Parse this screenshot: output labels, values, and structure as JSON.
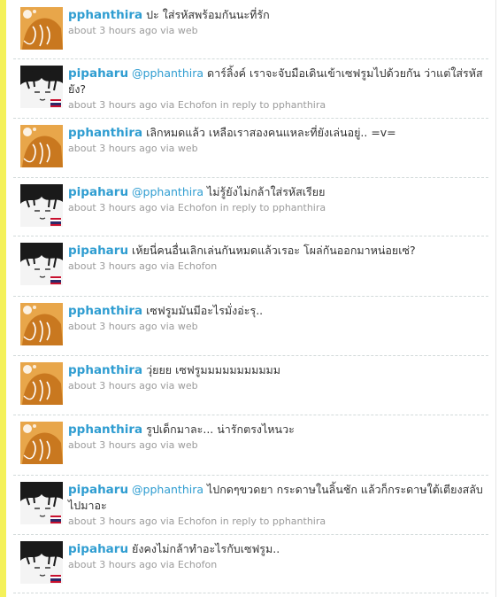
{
  "tweets": [
    {
      "user": "pphanthira",
      "avatar": "orange",
      "mention": "",
      "text": "ปะ ใส่รหัสพร้อมกันนะที่รัก",
      "time": "about 3 hours ago",
      "via": "via",
      "source": "web",
      "reply_prefix": "",
      "reply_to": ""
    },
    {
      "user": "pipaharu",
      "avatar": "sketch",
      "mention": "@pphanthira",
      "text": "ดาร์ลิ้งค์ เราจะจับมือเดินเข้าเซฟรูมไปด้วยกัน ว่าแต่ใส่รหัสยัง?",
      "time": "about 3 hours ago",
      "via": "via",
      "source": "Echofon",
      "reply_prefix": "in reply to",
      "reply_to": "pphanthira"
    },
    {
      "user": "pphanthira",
      "avatar": "orange",
      "mention": "",
      "text": "เลิกหมดแล้ว เหลือเราสองคนแหละที่ยังเล่นอยู่.. =v=",
      "time": "about 3 hours ago",
      "via": "via",
      "source": "web",
      "reply_prefix": "",
      "reply_to": ""
    },
    {
      "user": "pipaharu",
      "avatar": "sketch",
      "mention": "@pphanthira",
      "text": "ไม่รู้ยังไม่กล้าใส่รหัสเรียย",
      "time": "about 3 hours ago",
      "via": "via",
      "source": "Echofon",
      "reply_prefix": "in reply to",
      "reply_to": "pphanthira"
    },
    {
      "user": "pipaharu",
      "avatar": "sketch",
      "mention": "",
      "text": "เห้ยนี่คนอื่นเลิกเล่นกันหมดแล้วเรอะ โผล่กันออกมาหน่อยเซ่?",
      "time": "about 3 hours ago",
      "via": "via",
      "source": "Echofon",
      "reply_prefix": "",
      "reply_to": ""
    },
    {
      "user": "pphanthira",
      "avatar": "orange",
      "mention": "",
      "text": "เซฟรูมมันมีอะไรมั่งอ่ะรุ..",
      "time": "about 3 hours ago",
      "via": "via",
      "source": "web",
      "reply_prefix": "",
      "reply_to": ""
    },
    {
      "user": "pphanthira",
      "avatar": "orange",
      "mention": "",
      "text": "วุ่ยยย เซฟรูมมมมมมมมมมม",
      "time": "about 3 hours ago",
      "via": "via",
      "source": "web",
      "reply_prefix": "",
      "reply_to": ""
    },
    {
      "user": "pphanthira",
      "avatar": "orange",
      "mention": "",
      "text": "รูปเด็กมาละ... น่ารักตรงไหนวะ",
      "time": "about 3 hours ago",
      "via": "via",
      "source": "web",
      "reply_prefix": "",
      "reply_to": ""
    },
    {
      "user": "pipaharu",
      "avatar": "sketch",
      "mention": "@pphanthira",
      "text": "ไปกดๆขวดยา กระดาษในลิ้นชัก แล้วก็กระดาษใต้เตียงสลับไปมาอะ",
      "time": "about 3 hours ago",
      "via": "via",
      "source": "Echofon",
      "reply_prefix": "in reply to",
      "reply_to": "pphanthira"
    },
    {
      "user": "pipaharu",
      "avatar": "sketch",
      "mention": "",
      "text": "ยังคงไม่กล้าทำอะไรกับเซฟรูม..",
      "time": "about 3 hours ago",
      "via": "via",
      "source": "Echofon",
      "reply_prefix": "",
      "reply_to": ""
    }
  ]
}
